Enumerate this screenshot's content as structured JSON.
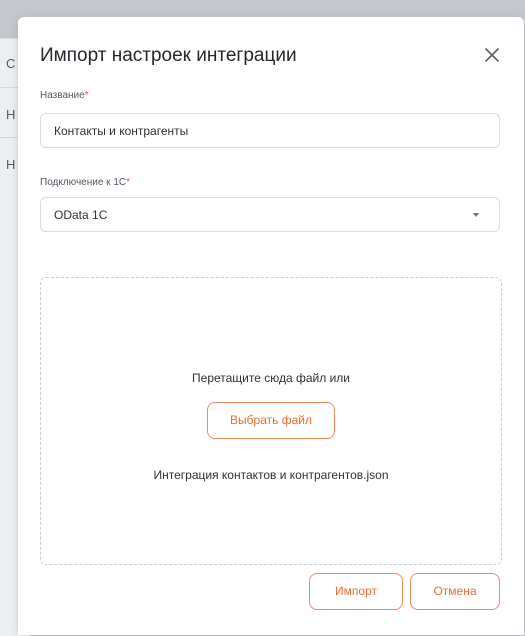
{
  "background": {
    "letters": [
      "С",
      "Н",
      "Н"
    ]
  },
  "modal": {
    "title": "Импорт настроек интеграции",
    "name_field": {
      "label": "Название",
      "required_mark": "*",
      "value": "Контакты и контрагенты"
    },
    "connection_field": {
      "label": "Подключение к 1С",
      "required_mark": "*",
      "value": "OData 1C"
    },
    "dropzone": {
      "hint": "Перетащите сюда файл или",
      "choose_button": "Выбрать файл",
      "file_name": "Интеграция контактов и контрагентов.json"
    },
    "footer": {
      "import_button": "Импорт",
      "cancel_button": "Отмена"
    }
  },
  "colors": {
    "accent": "#ee6a33",
    "required": "#e8503a"
  },
  "icons": {
    "close": "close-icon",
    "dropdown": "chevron-down-icon"
  }
}
